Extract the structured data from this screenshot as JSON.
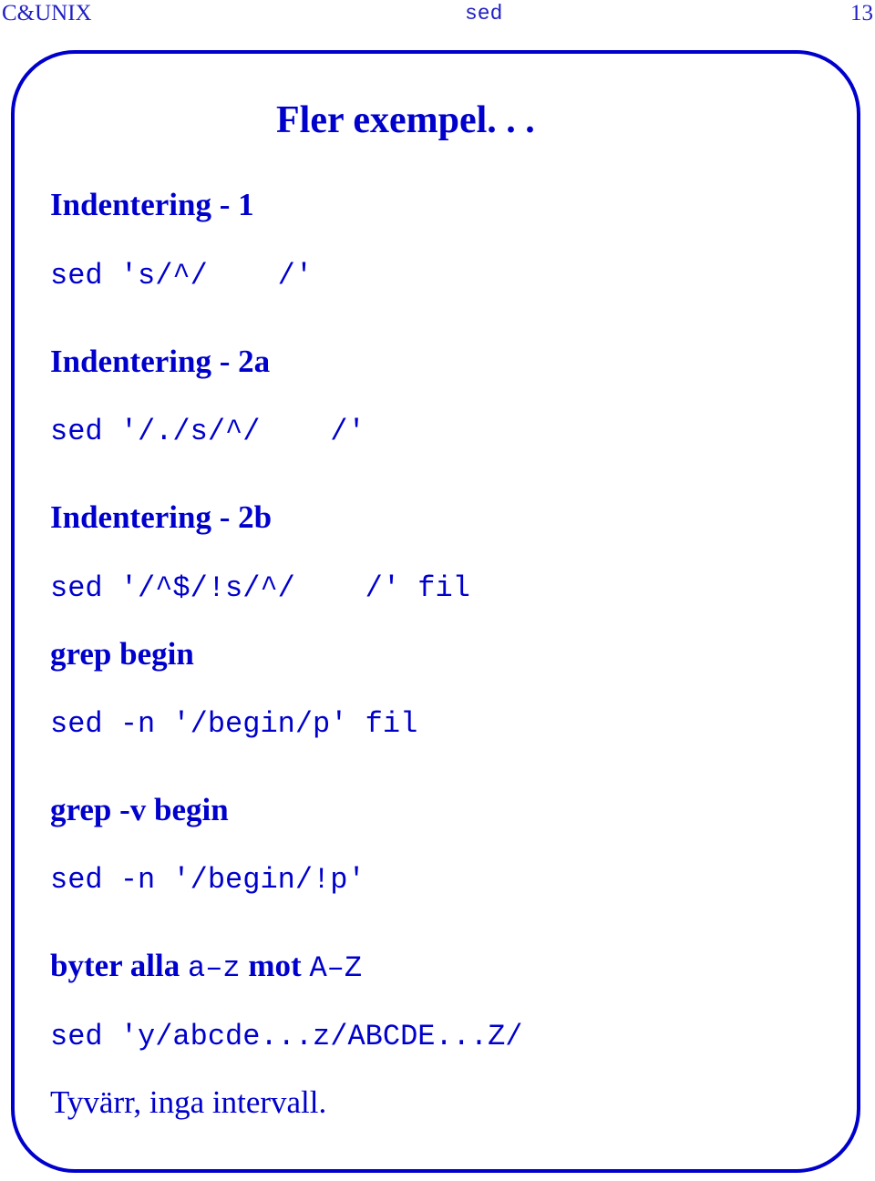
{
  "header": {
    "left": "C&UNIX",
    "center": "sed",
    "page_number": "13"
  },
  "slide": {
    "title": "Fler exempel. . .",
    "blocks": [
      {
        "heading": "Indentering - 1",
        "code": "sed 's/^/    /'"
      },
      {
        "heading": "Indentering - 2a",
        "code": "sed '/./s/^/    /'"
      },
      {
        "heading": "Indentering - 2b",
        "code": "sed '/^$/!s/^/    /' fil"
      },
      {
        "heading": "grep begin",
        "code": "sed -n '/begin/p' fil"
      },
      {
        "heading": "grep -v begin",
        "code": "sed -n '/begin/!p'"
      }
    ],
    "last_block": {
      "heading_parts": [
        "byter alla ",
        "a–z",
        " mot ",
        "A–Z"
      ],
      "code": "sed 'y/abcde...z/ABCDE...Z/",
      "note": "Tyvärr, inga intervall."
    }
  }
}
